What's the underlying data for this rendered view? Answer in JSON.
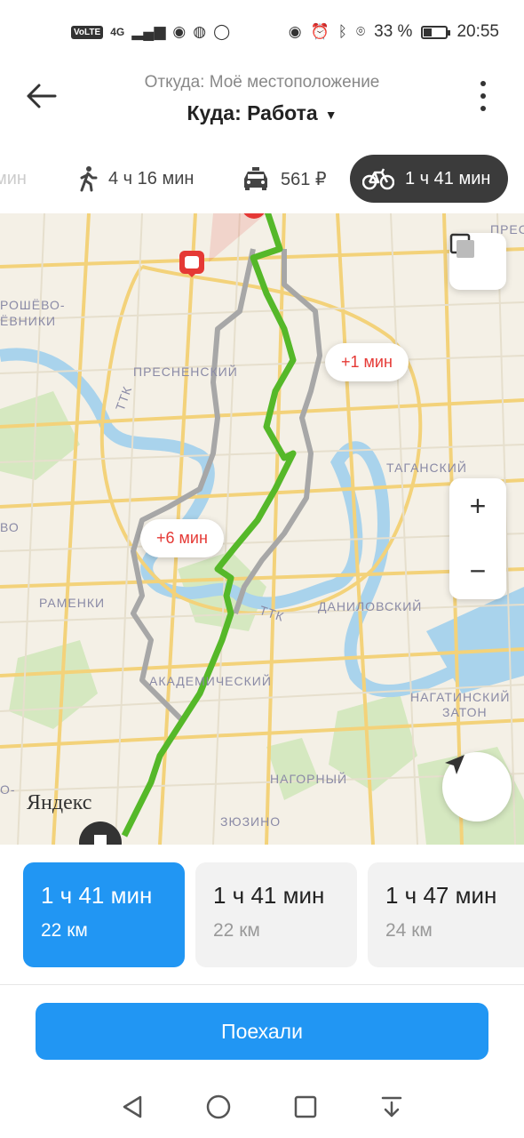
{
  "status": {
    "volte": "VoLTE",
    "network": "4G",
    "battery_pct": "33 %",
    "battery_level": 0.33,
    "time": "20:55"
  },
  "header": {
    "from": "Откуда: Моё местоположение",
    "to": "Куда: Работа",
    "caret": "▼"
  },
  "modes": {
    "prev_partial": "мин",
    "walk": "4 ч 16 мин",
    "taxi": "561 ₽",
    "bike": "1 ч 41 мин"
  },
  "map": {
    "labels": {
      "presnensky": "ПРЕСНЕНСКИЙ",
      "khoroshevo": "РОШЁВО-",
      "mnevniki": "ЁВНИКИ",
      "ttk1": "ТТК",
      "ttk2": "ТТК",
      "taganskiy": "ТАГАНСКИЙ",
      "danilovskiy": "ДАНИЛОВСКИЙ",
      "ramenki": "РАМЕНКИ",
      "akademicheskiy": "АКАДЕМИЧЕСКИЙ",
      "nagatinsky1": "НАГАТИНСКИЙ",
      "nagatinsky2": "ЗАТОН",
      "nagorny": "НАГОРНЫЙ",
      "zyuzino": "ЗЮЗИНО",
      "vo": "ВО",
      "presn_partial": "ПРЕС",
      "o_partial": "О-"
    },
    "bubble_1": "+1 мин",
    "bubble_2": "+6 мин",
    "logo": "Яндекс",
    "zoom_in": "+",
    "zoom_out": "−"
  },
  "routes": [
    {
      "time": "1 ч 41 мин",
      "dist": "22 км",
      "selected": true
    },
    {
      "time": "1 ч 41 мин",
      "dist": "22 км",
      "selected": false
    },
    {
      "time": "1 ч 47 мин",
      "dist": "24 км",
      "selected": false
    }
  ],
  "go_label": "Поехали",
  "colors": {
    "accent": "#2196f3",
    "route_main": "#55b829",
    "route_alt": "#a7a7a7",
    "delay_text": "#e53935"
  }
}
